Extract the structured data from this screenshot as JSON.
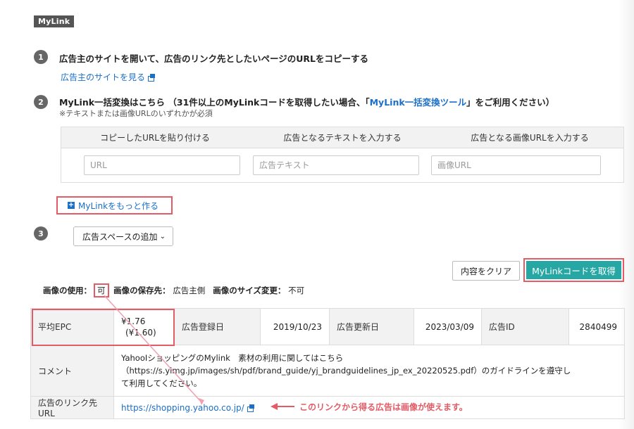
{
  "badge": "MyLink",
  "steps": [
    {
      "num": "1",
      "text": "広告主のサイトを開いて、広告のリンク先としたいページのURLをコピーする",
      "link": "広告主のサイトを見る"
    },
    {
      "num": "2",
      "text_before": "MyLink一括変換はこちら （31件以上のMyLinkコードを取得したい場合、「",
      "link": "MyLink一括変換ツール",
      "text_after": "」をご利用ください）",
      "note": "※テキストまたは画像URLのいずれかが必須"
    },
    {
      "num": "3"
    }
  ],
  "input_table": {
    "headers": [
      "コピーしたURLを貼り付ける",
      "広告となるテキストを入力する",
      "広告となる画像URLを入力する"
    ],
    "placeholders": {
      "url": "URL",
      "text": "広告テキスト",
      "image": "画像URL"
    }
  },
  "more_button": "MyLinkをもっと作る",
  "ad_space_select": "広告スペースの追加",
  "buttons": {
    "clear": "内容をクリア",
    "get_code": "MyLinkコードを取得"
  },
  "usage": {
    "image_use_label": "画像の使用：",
    "image_use_value": "可",
    "storage_label": "画像の保存先：",
    "storage_value": "広告主側",
    "resize_label": "画像のサイズ変更：",
    "resize_value": "不可"
  },
  "info": {
    "epc_label": "平均EPC",
    "epc_value": "¥1.76",
    "epc_sub": "(¥1.60)",
    "registered_label": "広告登録日",
    "registered_value": "2019/10/23",
    "updated_label": "広告更新日",
    "updated_value": "2023/03/09",
    "ad_id_label": "広告ID",
    "ad_id_value": "2840499",
    "comment_label": "コメント",
    "comment_lines": [
      "YahooIショッピングのMylink　素材の利用に関してはこちら",
      "（https://s.yimg.jp/images/sh/pdf/brand_guide/yj_brandguidelines_jp_ex_20220525.pdf）のガイドラインを遵守し",
      "て利用してください。"
    ],
    "link_label": "広告のリンク先URL",
    "link_value": "https://shopping.yahoo.co.jp/"
  },
  "annotation": "このリンクから得る広告は画像が使えます。",
  "colors": {
    "accent": "#e35b66",
    "teal": "#27a7a3",
    "link": "#1a6fc9"
  }
}
